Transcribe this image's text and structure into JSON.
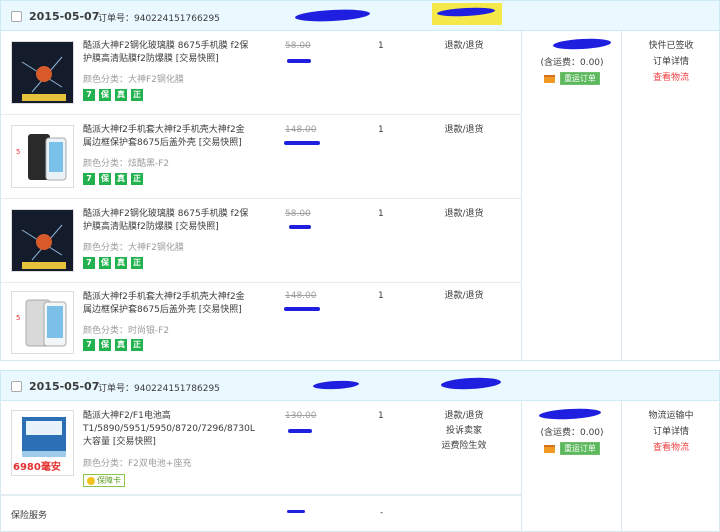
{
  "orders": [
    {
      "date": "2015-05-07",
      "order_label": "订单号：940224151766295",
      "shipping": "(含运费：0.00)",
      "express_btn": "重运订单",
      "status": [
        "快件已签收",
        "订单详情",
        "查看物流"
      ],
      "items": [
        {
          "title": "酷派大神F2钢化玻璃膜 8675手机膜 f2保护膜高清贴膜f2防爆膜 [交易快照]",
          "spec": "颜色分类：大神F2钢化膜",
          "price": "58.00",
          "qty": "1",
          "ops": [
            "退款/退货"
          ],
          "tags": [
            "7",
            "保",
            "真",
            "正"
          ]
        },
        {
          "title": "酷派大神f2手机套大神f2手机壳大神f2金属边框保护套8675后盖外壳 [交易快照]",
          "spec": "颜色分类：炫酷黑-F2",
          "price": "148.00",
          "qty": "1",
          "ops": [
            "退款/退货"
          ],
          "tags": [
            "7",
            "保",
            "真",
            "正"
          ]
        },
        {
          "title": "酷派大神F2钢化玻璃膜 8675手机膜 f2保护膜高清贴膜f2防爆膜 [交易快照]",
          "spec": "颜色分类：大神F2钢化膜",
          "price": "58.00",
          "qty": "1",
          "ops": [
            "退款/退货"
          ],
          "tags": [
            "7",
            "保",
            "真",
            "正"
          ]
        },
        {
          "title": "酷派大神f2手机套大神f2手机壳大神f2金属边框保护套8675后盖外壳 [交易快照]",
          "spec": "颜色分类：时尚银-F2",
          "price": "148.00",
          "qty": "1",
          "ops": [
            "退款/退货"
          ],
          "tags": [
            "7",
            "保",
            "真",
            "正"
          ]
        }
      ]
    },
    {
      "date": "2015-05-07",
      "order_label": "订单号：940224151786295",
      "shipping": "(含运费：0.00)",
      "express_btn": "重运订单",
      "status": [
        "物流运输中",
        "订单详情",
        "查看物流"
      ],
      "items": [
        {
          "title": "酷派大神F2/F1电池高T1/5890/5951/5950/8720/7296/8730L大容量 [交易快照]",
          "spec": "颜色分类：F2双电池+座充",
          "price": "130.00",
          "qty": "1",
          "ops": [
            "退款/退货",
            "投诉卖家",
            "运费险生效"
          ],
          "thumb_text": "6980毫安",
          "insure": "保障卡"
        }
      ],
      "service_label": "保险服务",
      "service_qty": "-"
    }
  ]
}
